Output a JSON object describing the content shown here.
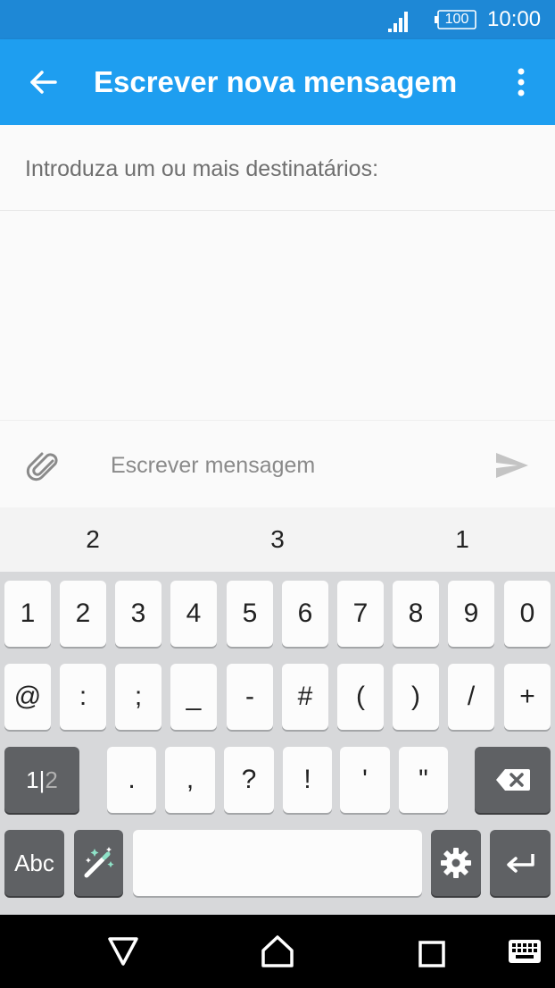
{
  "status_bar": {
    "battery": "100",
    "time": "10:00"
  },
  "app_bar": {
    "title": "Escrever nova mensagem"
  },
  "recipients": {
    "prompt": "Introduza um ou mais destinatários:"
  },
  "compose": {
    "placeholder": "Escrever mensagem"
  },
  "suggestions": [
    "2",
    "3",
    "1"
  ],
  "keyboard": {
    "row1": [
      "1",
      "2",
      "3",
      "4",
      "5",
      "6",
      "7",
      "8",
      "9",
      "0"
    ],
    "row2": [
      "@",
      ":",
      ";",
      "_",
      "-",
      "#",
      "(",
      ")",
      "/",
      "+"
    ],
    "row3": [
      ".",
      ",",
      "?",
      "!",
      "'",
      "\""
    ],
    "mode_key": {
      "primary": "1|",
      "secondary": "2"
    },
    "abc_key": "Abc"
  },
  "colors": {
    "status_bar": "#1e88d6",
    "app_bar": "#1e9ef0",
    "key_dark": "#5f6164",
    "keyboard_bg": "#d7d8da"
  }
}
